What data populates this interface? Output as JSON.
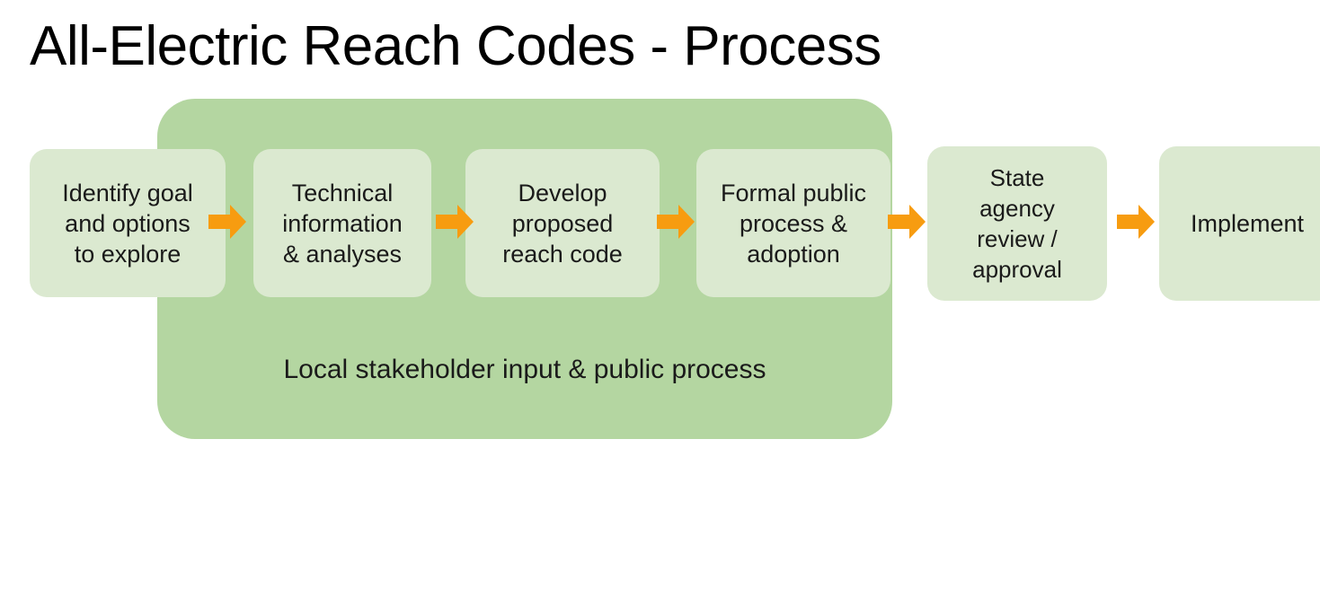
{
  "slide": {
    "title": "All-Electric Reach Codes - Process",
    "background_color": "#ffffff"
  },
  "colors": {
    "band_green": "#b4d6a1",
    "node_green": "#dbe9d0",
    "arrow_orange": "#f79c10",
    "text": "#1a1a1a"
  },
  "band": {
    "label": "Local stakeholder input & public process",
    "covers_steps": [
      1,
      2,
      3,
      4
    ]
  },
  "process": {
    "steps": [
      {
        "index": 1,
        "label": "Identify goal\nand options\nto explore",
        "lines": [
          "Identify goal",
          "and options",
          "to explore"
        ]
      },
      {
        "index": 2,
        "label": "Technical\ninformation\n& analyses",
        "lines": [
          "Technical",
          "information",
          "& analyses"
        ]
      },
      {
        "index": 3,
        "label": "Develop\nproposed\nreach code",
        "lines": [
          "Develop",
          "proposed",
          "reach code"
        ]
      },
      {
        "index": 4,
        "label": "Formal public\nprocess &\nadoption",
        "lines": [
          "Formal public",
          "process &",
          "adoption"
        ]
      },
      {
        "index": 5,
        "label": "State\nagency\nreview /\napproval",
        "lines": [
          "State",
          "agency",
          "review /",
          "approval"
        ]
      },
      {
        "index": 6,
        "label": "Implement",
        "lines": [
          "Implement"
        ]
      }
    ],
    "connectors": [
      {
        "from": 1,
        "to": 2,
        "icon": "arrow-right-icon"
      },
      {
        "from": 2,
        "to": 3,
        "icon": "arrow-right-icon"
      },
      {
        "from": 3,
        "to": 4,
        "icon": "arrow-right-icon"
      },
      {
        "from": 4,
        "to": 5,
        "icon": "arrow-right-icon"
      },
      {
        "from": 5,
        "to": 6,
        "icon": "arrow-right-icon"
      }
    ]
  }
}
